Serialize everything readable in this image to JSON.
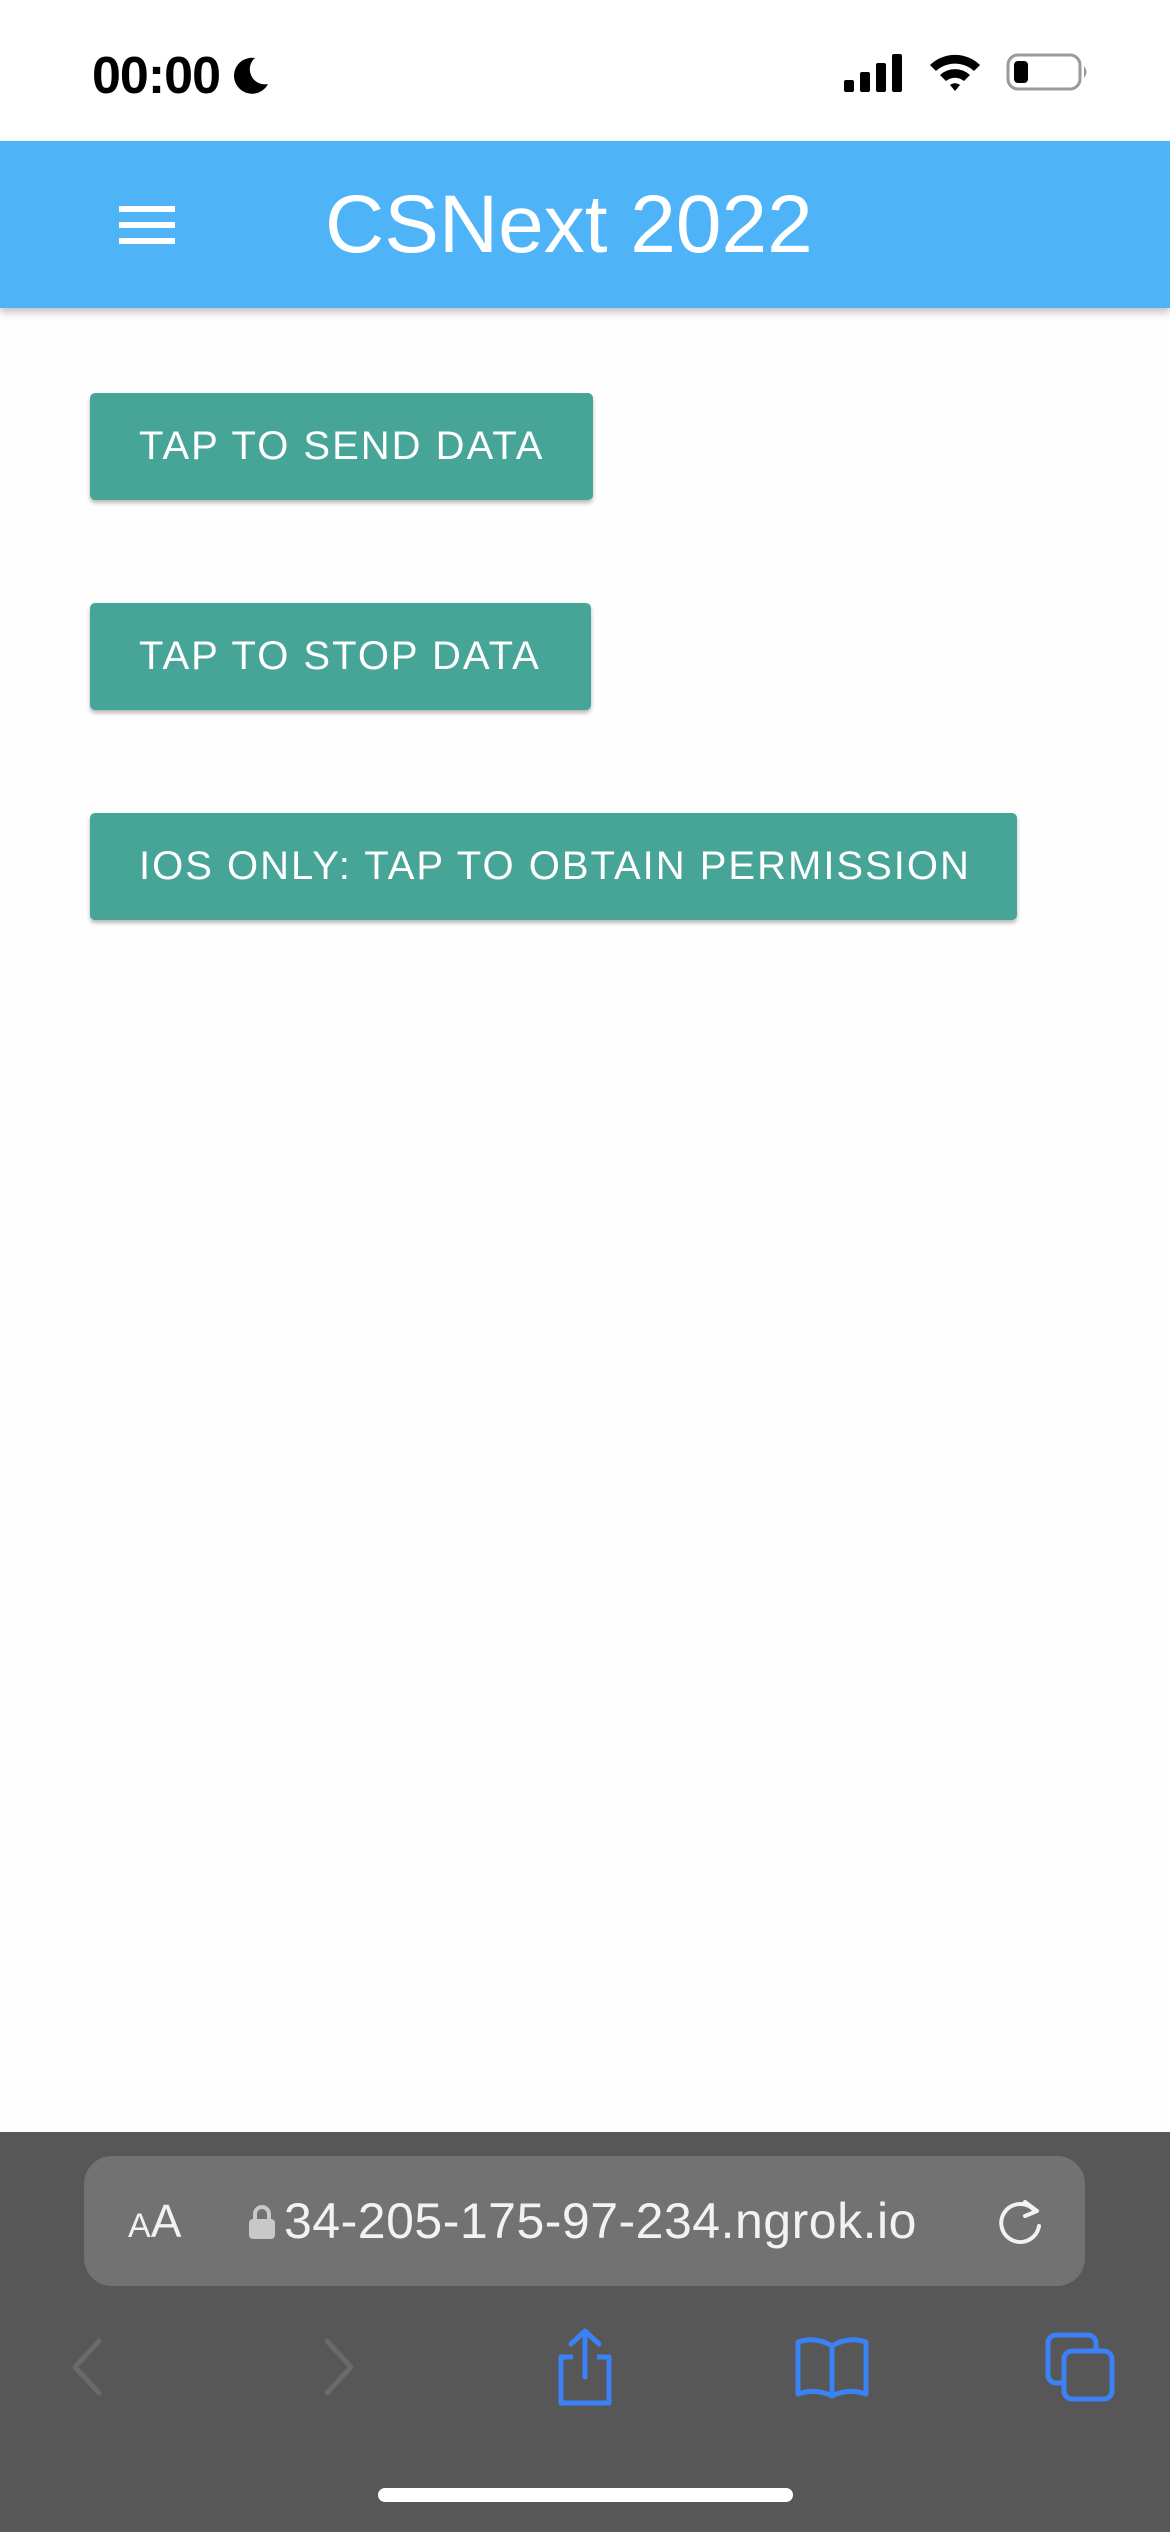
{
  "status_bar": {
    "time": "00:00",
    "icons": [
      "moon-icon",
      "cellular-signal-icon",
      "wifi-icon",
      "battery-icon"
    ]
  },
  "app_bar": {
    "title": "CSNext 2022",
    "menu_icon": "hamburger-menu-icon",
    "background": "#4fb4f7"
  },
  "buttons": {
    "send": "TAP TO SEND DATA",
    "stop": "TAP TO STOP DATA",
    "permission": "IOS ONLY: TAP TO OBTAIN PERMISSION",
    "color": "#47a597"
  },
  "safari": {
    "aa_small": "A",
    "aa_big": "A",
    "url": "34-205-175-97-234.ngrok.io",
    "icons": [
      "lock-icon",
      "reload-icon",
      "back-icon",
      "forward-icon",
      "share-icon",
      "bookmarks-icon",
      "tabs-icon"
    ],
    "accent": "#3b82f6"
  }
}
